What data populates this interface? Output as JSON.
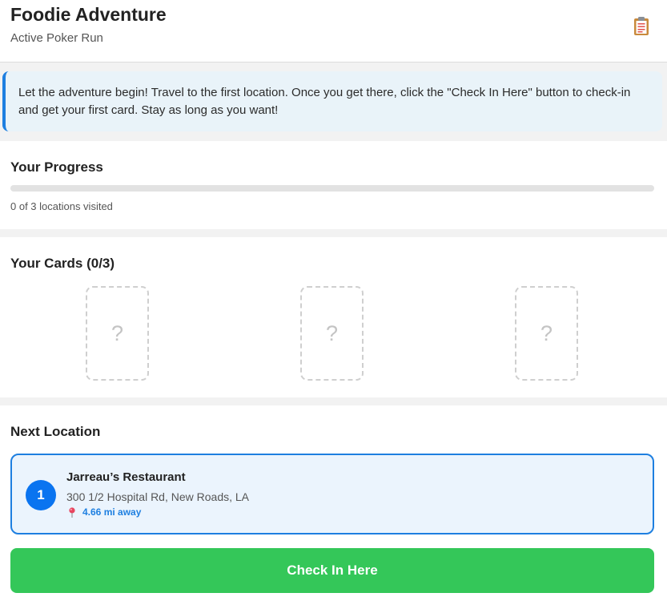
{
  "header": {
    "title": "Foodie Adventure",
    "subtitle": "Active Poker Run",
    "action_icon": "clipboard-icon"
  },
  "notice": {
    "text": "Let the adventure begin! Travel to the first location. Once you get there, click the \"Check In Here\" button to check-in and get your first card. Stay as long as you want!",
    "accent_color": "#1e7fe0"
  },
  "progress": {
    "title": "Your Progress",
    "status_text": "0 of 3 locations visited",
    "visited": 0,
    "total": 3,
    "fill_fraction": 0
  },
  "cards": {
    "title": "Your Cards (0/3)",
    "slots": [
      {
        "placeholder": "?"
      },
      {
        "placeholder": "?"
      },
      {
        "placeholder": "?"
      }
    ]
  },
  "next_location": {
    "title": "Next Location",
    "number": "1",
    "name": "Jarreau’s Restaurant",
    "address": "300 1/2 Hospital Rd, New Roads, LA",
    "distance": "4.66 mi away",
    "distance_icon": "map-pin-icon"
  },
  "actions": {
    "check_in_label": "Check In Here",
    "check_in_color": "#34c759"
  }
}
